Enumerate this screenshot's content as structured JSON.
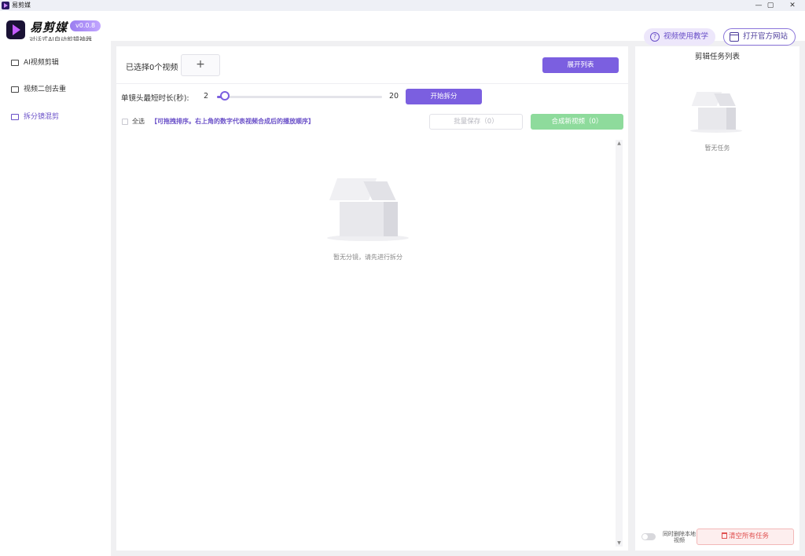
{
  "window": {
    "title": "易剪媒",
    "controls": [
      "—",
      "▢",
      "✕"
    ]
  },
  "header": {
    "app_name": "易剪媒",
    "version": "v0.0.8",
    "subtitle": "对话式AI自动剪辑神器",
    "tutorial_label": "视频使用教学",
    "website_label": "打开官方网站"
  },
  "sidebar": {
    "items": [
      {
        "label": "AI视频剪辑",
        "icon": "clapperboard-icon"
      },
      {
        "label": "视频二创去重",
        "icon": "video-camera-icon"
      },
      {
        "label": "拆分镜混剪",
        "icon": "film-strip-icon",
        "active": true
      }
    ]
  },
  "main": {
    "selected_label": "已选择0个视频",
    "add_symbol": "+",
    "expand_label": "展开列表",
    "duration_label": "单镜头最短时长(秒):",
    "slider": {
      "min": "2",
      "max": "20",
      "value": 2
    },
    "start_label": "开始拆分",
    "select_all_label": "全选",
    "hint": "【可拖拽排序。右上角的数字代表视频合成后的播放顺序】",
    "batch_save_label": "批量保存（0）",
    "compose_label": "合成新视频（0）",
    "empty_text": "暂无分镜，请先进行拆分"
  },
  "task_panel": {
    "title": "剪辑任务列表",
    "empty_text": "暂无任务",
    "delete_local_label": "同时删除本地视频",
    "clear_label": "清空所有任务"
  },
  "colors": {
    "accent": "#7b5fe0",
    "success": "#8edb9c",
    "danger": "#e05050"
  }
}
